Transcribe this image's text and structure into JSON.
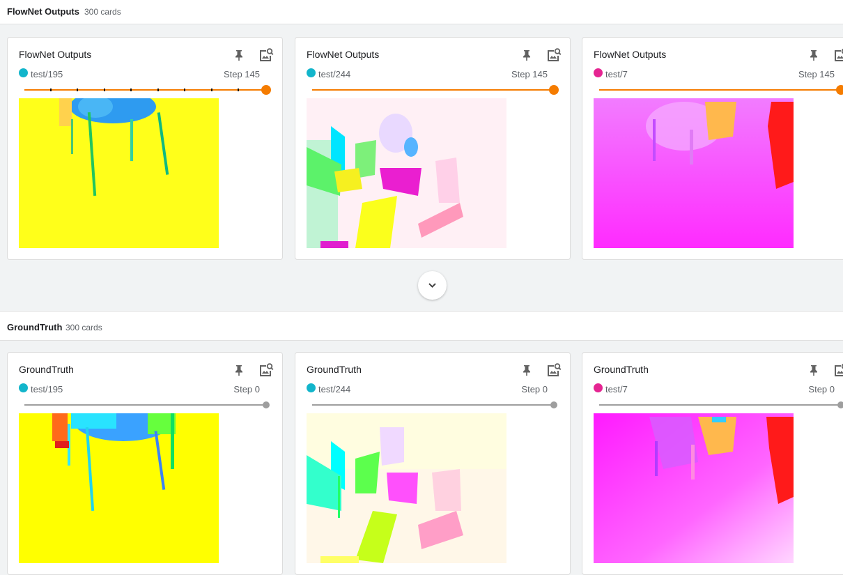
{
  "colors": {
    "accent_orange": "#f57c00",
    "run_cyan": "#12b5cb",
    "run_magenta": "#e52592",
    "slider_gray": "#9e9e9e"
  },
  "sections": [
    {
      "title": "FlowNet Outputs",
      "count": "300 cards"
    },
    {
      "title": "GroundTruth",
      "count": "300 cards"
    }
  ],
  "flownet_cards": [
    {
      "title": "FlowNet Outputs",
      "run": "test/195",
      "step": "Step 145",
      "run_color": "#12b5cb",
      "step_fraction": 1.0
    },
    {
      "title": "FlowNet Outputs",
      "run": "test/244",
      "step": "Step 145",
      "run_color": "#12b5cb",
      "step_fraction": 1.0
    },
    {
      "title": "FlowNet Outputs",
      "run": "test/7",
      "step": "Step 145",
      "run_color": "#e52592",
      "step_fraction": 1.0
    }
  ],
  "groundtruth_cards": [
    {
      "title": "GroundTruth",
      "run": "test/195",
      "step": "Step 0",
      "run_color": "#12b5cb",
      "step_fraction": 1.0
    },
    {
      "title": "GroundTruth",
      "run": "test/244",
      "step": "Step 0",
      "run_color": "#12b5cb",
      "step_fraction": 1.0
    },
    {
      "title": "GroundTruth",
      "run": "test/7",
      "step": "Step 0",
      "run_color": "#e52592",
      "step_fraction": 1.0
    }
  ],
  "icons": {
    "pin": "pin-icon",
    "zoom": "image-search-icon",
    "expand": "chevron-down-icon"
  }
}
